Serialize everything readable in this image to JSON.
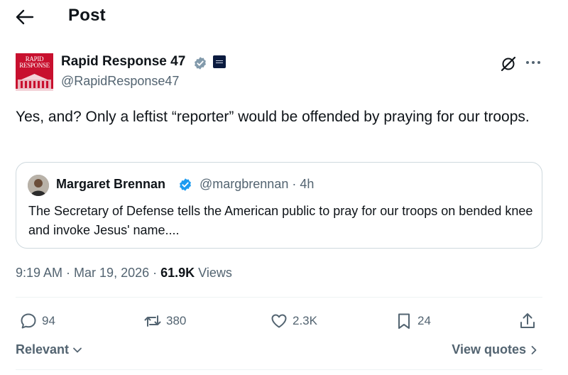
{
  "header": {
    "title": "Post",
    "back_icon": "arrow-left-icon"
  },
  "author": {
    "avatar_text_line1": "RAPID",
    "avatar_text_line2": "RESPONSE",
    "name": "Rapid Response 47",
    "handle": "@RapidResponse47",
    "verified": true,
    "verified_color": "#829aab"
  },
  "post": {
    "text": "Yes, and? Only a leftist “reporter” would be offended by praying for our troops."
  },
  "quote": {
    "name": "Margaret Brennan",
    "handle_time": "@margbrennan · 4h",
    "verified_color": "#1d9bf0",
    "text": "The Secretary of Defense tells the American public to pray for our troops on bended knee and invoke Jesus' name...."
  },
  "meta": {
    "time": "9:19 AM",
    "sep1": " · ",
    "date": "Mar 19, 2026",
    "sep2": " · ",
    "views_count": "61.9K",
    "views_label": " Views"
  },
  "actions": {
    "replies": "94",
    "reposts": "380",
    "likes": "2.3K",
    "bookmarks": "24"
  },
  "footer": {
    "sort_label": "Relevant",
    "view_quotes_label": "View quotes"
  },
  "colors": {
    "text": "#0f1419",
    "secondary": "#536471",
    "border": "#cfd9de",
    "brand_red": "#c8102e",
    "accent_blue": "#1d9bf0"
  }
}
